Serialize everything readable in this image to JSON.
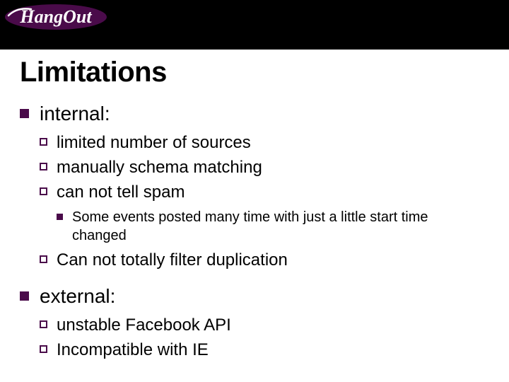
{
  "header": {
    "logo_name": "hangout-logo"
  },
  "title": "Limitations",
  "sections": [
    {
      "heading": "internal:",
      "items": [
        {
          "text": "limited number of sources"
        },
        {
          "text": "manually schema matching"
        },
        {
          "text": "can not tell spam",
          "subitems": [
            "Some events posted many time with just a little start time changed"
          ]
        },
        {
          "text": "Can not totally filter duplication"
        }
      ]
    },
    {
      "heading": "external:",
      "items": [
        {
          "text": "unstable Facebook API"
        },
        {
          "text": "Incompatible with IE"
        }
      ]
    }
  ]
}
